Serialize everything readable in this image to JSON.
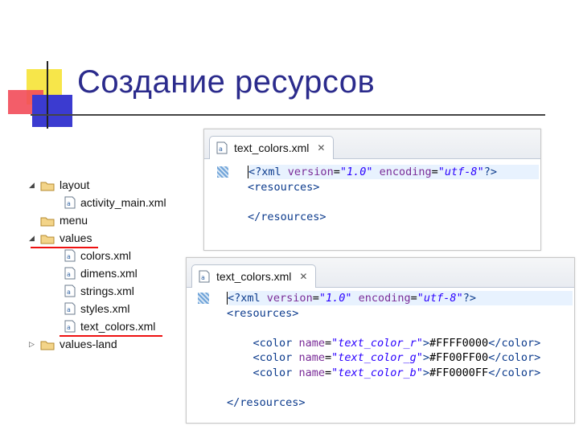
{
  "slide": {
    "title": "Создание ресурсов"
  },
  "tree": {
    "items": [
      {
        "label": "layout",
        "kind": "folder",
        "expanded": true
      },
      {
        "label": "activity_main.xml",
        "kind": "file"
      },
      {
        "label": "menu",
        "kind": "folder",
        "expanded": false
      },
      {
        "label": "values",
        "kind": "folder",
        "expanded": true
      },
      {
        "label": "colors.xml",
        "kind": "file"
      },
      {
        "label": "dimens.xml",
        "kind": "file"
      },
      {
        "label": "strings.xml",
        "kind": "file"
      },
      {
        "label": "styles.xml",
        "kind": "file"
      },
      {
        "label": "text_colors.xml",
        "kind": "file"
      },
      {
        "label": "values-land",
        "kind": "folder",
        "expanded": false
      }
    ]
  },
  "editor1": {
    "tab_label": "text_colors.xml",
    "close_glyph": "✕",
    "lines": {
      "l1": {
        "open": "<?",
        "name": "xml",
        "a1": "version",
        "eq": "=",
        "v1": "\"1.0\"",
        "a2": "encoding",
        "v2": "\"utf-8\"",
        "close": "?>"
      },
      "l2": "<resources>",
      "l3": "</resources>"
    }
  },
  "editor2": {
    "tab_label": "text_colors.xml",
    "close_glyph": "✕",
    "lines": {
      "l1": {
        "open": "<?",
        "name": "xml",
        "a1": "version",
        "eq": "=",
        "v1": "\"1.0\"",
        "a2": "encoding",
        "v2": "\"utf-8\"",
        "close": "?>"
      },
      "l2": "<resources>",
      "colors": [
        {
          "open": "<color",
          "attr": "name",
          "eq": "=",
          "value": "\"text_color_r\"",
          "gt": ">",
          "text": "#FFFF0000",
          "close": "</color>"
        },
        {
          "open": "<color",
          "attr": "name",
          "eq": "=",
          "value": "\"text_color_g\"",
          "gt": ">",
          "text": "#FF00FF00",
          "close": "</color>"
        },
        {
          "open": "<color",
          "attr": "name",
          "eq": "=",
          "value": "\"text_color_b\"",
          "gt": ">",
          "text": "#FF0000FF",
          "close": "</color>"
        }
      ],
      "l_end": "</resources>"
    }
  },
  "colors": {
    "title": "#2b2b8c",
    "highlight_underline": "#ee1111",
    "xml_tag": "#0b3a8c",
    "xml_attr": "#7a2c98",
    "xml_string": "#2a00ff"
  },
  "icons": {
    "folder": "folder-icon",
    "file": "xml-file-icon",
    "expanded": "triangle-expanded-icon",
    "collapsed": "triangle-collapsed-icon",
    "close": "close-tab-icon"
  }
}
